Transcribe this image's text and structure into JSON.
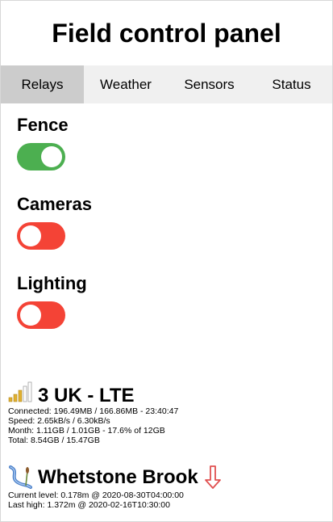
{
  "header": {
    "title": "Field control panel"
  },
  "tabs": [
    {
      "label": "Relays",
      "active": true
    },
    {
      "label": "Weather",
      "active": false
    },
    {
      "label": "Sensors",
      "active": false
    },
    {
      "label": "Status",
      "active": false
    }
  ],
  "relays": [
    {
      "label": "Fence",
      "state": "on"
    },
    {
      "label": "Cameras",
      "state": "off"
    },
    {
      "label": "Lighting",
      "state": "off"
    }
  ],
  "colors": {
    "on": "#4caf50",
    "off": "#f44336",
    "tab_bar": "#f0f0f0",
    "tab_active": "#cccccc"
  },
  "network": {
    "icon": "signal-bars-icon",
    "title": "3 UK - LTE",
    "connected": "Connected: 196.49MB / 166.86MB - 23:40:47",
    "speed": "Speed: 2.65kB/s / 6.30kB/s",
    "month": "Month: 1.11GB / 1.01GB - 17.6% of 12GB",
    "total": "Total: 8.54GB / 15.47GB"
  },
  "river": {
    "icon": "river-icon",
    "title": "Whetstone Brook",
    "trend": "falling",
    "trend_icon": "down-arrow-icon",
    "current": "Current level: 0.178m @ 2020-08-30T04:00:00",
    "last_high": "Last high: 1.372m @ 2020-02-16T10:30:00"
  }
}
